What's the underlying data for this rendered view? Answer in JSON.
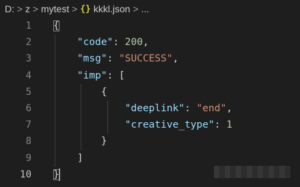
{
  "breadcrumb": {
    "items": [
      "D:",
      "z",
      "mytest",
      "kkkl.json",
      "..."
    ],
    "separator": ">",
    "json_icon": "{}"
  },
  "gutter": {
    "line_numbers": [
      "1",
      "2",
      "3",
      "4",
      "5",
      "6",
      "7",
      "8",
      "9",
      "10"
    ],
    "active_line": "10"
  },
  "code": {
    "lines": [
      {
        "tokens": [
          {
            "t": "punct",
            "v": "{"
          }
        ]
      },
      {
        "tokens": [
          {
            "t": "punct",
            "v": "    "
          },
          {
            "t": "key",
            "v": "\"code\""
          },
          {
            "t": "punct",
            "v": ": "
          },
          {
            "t": "num",
            "v": "200"
          },
          {
            "t": "punct",
            "v": ","
          }
        ]
      },
      {
        "tokens": [
          {
            "t": "punct",
            "v": "    "
          },
          {
            "t": "key",
            "v": "\"msg\""
          },
          {
            "t": "punct",
            "v": ": "
          },
          {
            "t": "str",
            "v": "\"SUCCESS\""
          },
          {
            "t": "punct",
            "v": ","
          }
        ]
      },
      {
        "tokens": [
          {
            "t": "punct",
            "v": "    "
          },
          {
            "t": "key",
            "v": "\"imp\""
          },
          {
            "t": "punct",
            "v": ": ["
          }
        ]
      },
      {
        "tokens": [
          {
            "t": "punct",
            "v": "        {"
          }
        ]
      },
      {
        "tokens": [
          {
            "t": "punct",
            "v": "            "
          },
          {
            "t": "key",
            "v": "\"deeplink\""
          },
          {
            "t": "punct",
            "v": ": "
          },
          {
            "t": "str",
            "v": "\"end\""
          },
          {
            "t": "punct",
            "v": ","
          }
        ]
      },
      {
        "tokens": [
          {
            "t": "punct",
            "v": "            "
          },
          {
            "t": "key",
            "v": "\"creative_type\""
          },
          {
            "t": "punct",
            "v": ": "
          },
          {
            "t": "num",
            "v": "1"
          }
        ]
      },
      {
        "tokens": [
          {
            "t": "punct",
            "v": "        }"
          }
        ]
      },
      {
        "tokens": [
          {
            "t": "punct",
            "v": "    ]"
          }
        ]
      },
      {
        "tokens": [
          {
            "t": "punct",
            "v": "}"
          }
        ]
      }
    ]
  },
  "colors": {
    "background": "#1e1e1e",
    "key": "#9cdcfe",
    "string": "#ce9178",
    "number": "#b5cea8",
    "punctuation": "#d4d4d4",
    "line_number": "#858585"
  }
}
